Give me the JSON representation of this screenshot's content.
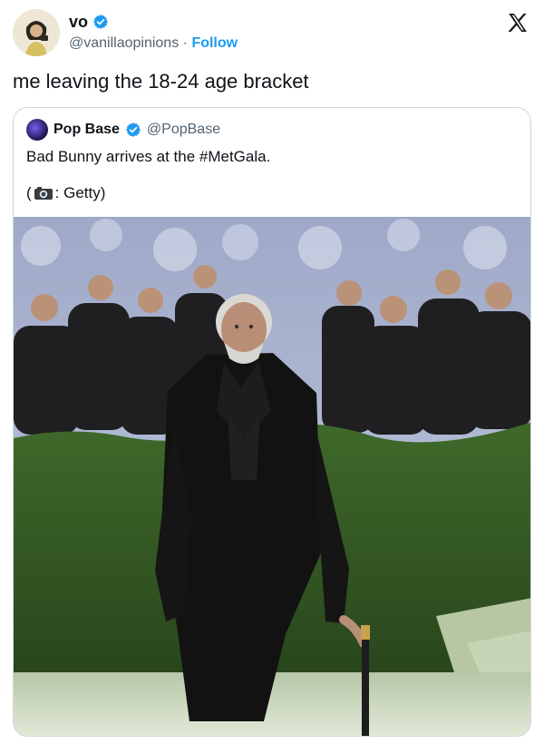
{
  "tweet": {
    "author_name": "vo",
    "author_handle": "@vanillaopinions",
    "separator": "·",
    "follow_label": "Follow",
    "text": "me leaving the 18-24 age bracket"
  },
  "quote": {
    "author_name": "Pop Base",
    "author_handle": "@PopBase",
    "text": "Bad Bunny arrives at the #MetGala.",
    "credit_open": "(",
    "credit_text": ": Getty)"
  },
  "icons": {
    "verified": "verified-badge-icon",
    "platform": "x-logo-icon",
    "camera": "camera-emoji-icon"
  },
  "colors": {
    "link_blue": "#1d9bf0",
    "secondary_text": "#536471",
    "border": "#cfd9de"
  }
}
